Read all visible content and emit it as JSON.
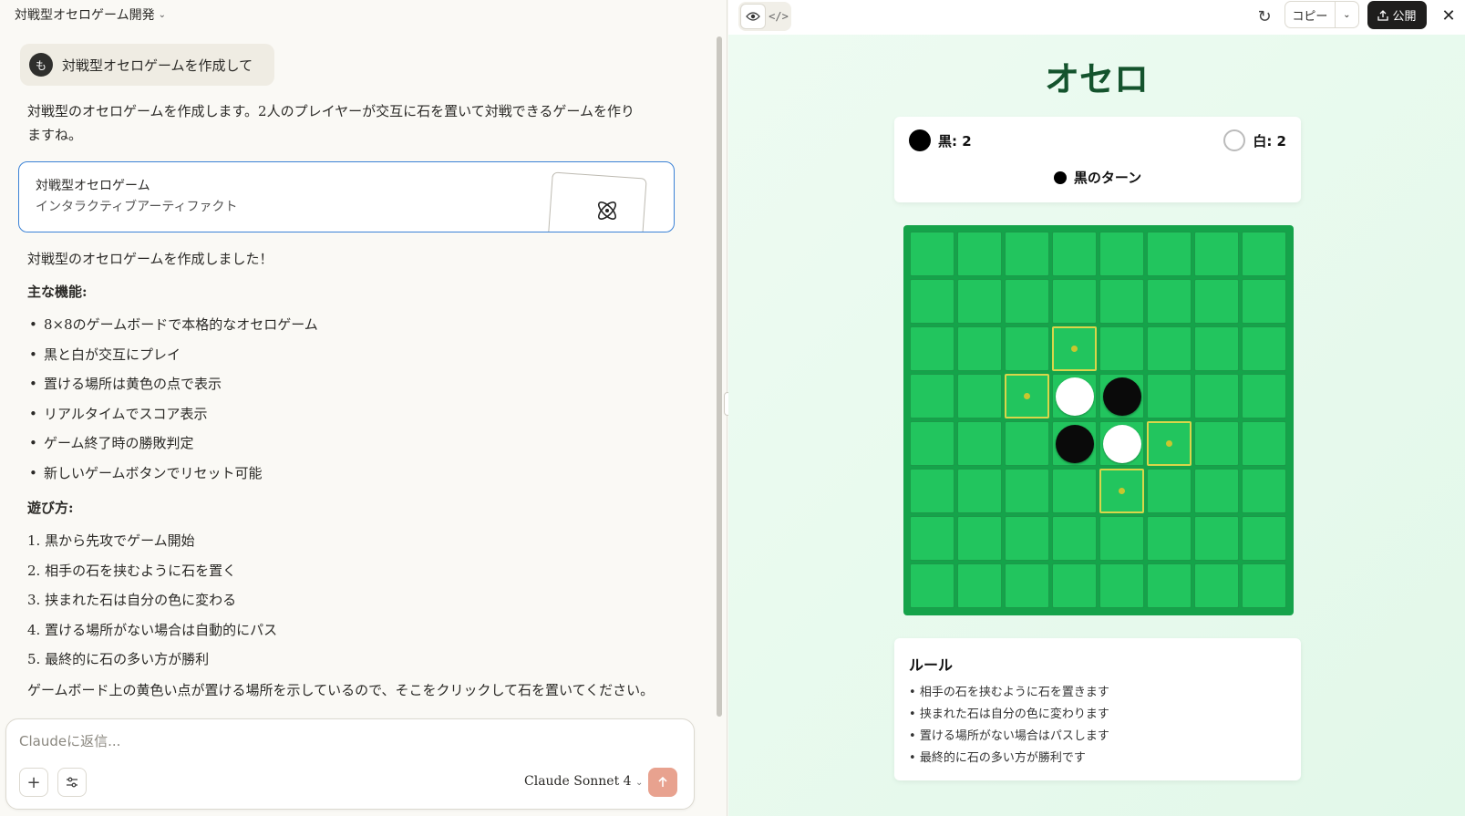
{
  "conversation": {
    "title": "対戦型オセロゲーム開発",
    "user_message": "対戦型オセロゲームを作成して",
    "user_initial": "も",
    "intro": "対戦型のオセロゲームを作成します。2人のプレイヤーが交互に石を置いて対戦できるゲームを作りますね。",
    "artifact": {
      "title": "対戦型オセロゲーム",
      "subtitle": "インタラクティブアーティファクト"
    },
    "done": "対戦型のオセロゲームを作成しました！",
    "features_heading": "主な機能:",
    "features": [
      "8×8のゲームボードで本格的なオセロゲーム",
      "黒と白が交互にプレイ",
      "置ける場所は黄色の点で表示",
      "リアルタイムでスコア表示",
      "ゲーム終了時の勝敗判定",
      "新しいゲームボタンでリセット可能"
    ],
    "howto_heading": "遊び方:",
    "howto": [
      "1. 黒から先攻でゲーム開始",
      "2. 相手の石を挟むように石を置く",
      "3. 挟まれた石は自分の色に変わる",
      "4. 置ける場所がない場合は自動的にパス",
      "5. 最終的に石の多い方が勝利"
    ],
    "footer": "ゲームボード上の黄色い点が置ける場所を示しているので、そこをクリックして石を置いてください。オセロの戦略を楽しんでくださいね！"
  },
  "composer": {
    "placeholder": "Claudeに返信...",
    "model": "Claude Sonnet 4"
  },
  "toolbar": {
    "copy_label": "コピー",
    "publish_label": "公開"
  },
  "game": {
    "title": "オセロ",
    "black_score": "黒: 2",
    "white_score": "白: 2",
    "turn": "黒のターン",
    "board": [
      "........",
      "........",
      "...v....",
      "..vWB...",
      "...BWv..",
      "....v...",
      "........",
      "........"
    ],
    "rules_title": "ルール",
    "rules": [
      "相手の石を挟むように石を置きます",
      "挟まれた石は自分の色に変わります",
      "置ける場所がない場合はパスします",
      "最終的に石の多い方が勝利です"
    ],
    "colors": {
      "board": "#15a34a",
      "cell": "#22c55e",
      "title": "#14532d",
      "hint": "#c9c62e"
    }
  }
}
